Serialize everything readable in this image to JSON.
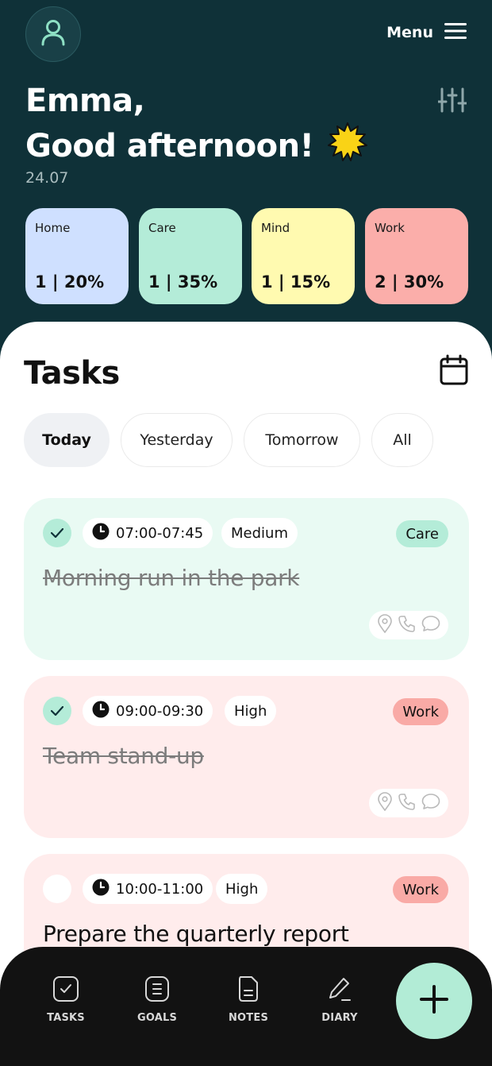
{
  "header": {
    "menu_label": "Menu",
    "name_line": "Emma,",
    "greeting_line": "Good afternoon!",
    "date": "24.07"
  },
  "categories": [
    {
      "name": "Home",
      "value": "1 | 20%",
      "color": "#cfe0ff"
    },
    {
      "name": "Care",
      "value": "1 | 35%",
      "color": "#b4ecd8"
    },
    {
      "name": "Mind",
      "value": "1 | 15%",
      "color": "#fffab0"
    },
    {
      "name": "Work",
      "value": "2 | 30%",
      "color": "#fbaeaa"
    }
  ],
  "tasks_section": {
    "title": "Tasks",
    "tabs": [
      {
        "label": "Today",
        "active": true
      },
      {
        "label": "Yesterday",
        "active": false
      },
      {
        "label": "Tomorrow",
        "active": false
      },
      {
        "label": "All",
        "active": false
      }
    ]
  },
  "tasks": [
    {
      "time": "07:00-07:45",
      "priority": "Medium",
      "category": "Care",
      "title": "Morning run in the park",
      "done": true,
      "card_color": "#e9faf3",
      "tag_color": "#b4ecd8"
    },
    {
      "time": "09:00-09:30",
      "priority": "High",
      "category": "Work",
      "title": "Team stand-up",
      "done": true,
      "card_color": "#ffecec",
      "tag_color": "#f9aaa6"
    },
    {
      "time": "10:00-11:00",
      "priority": "High",
      "category": "Work",
      "title": "Prepare the quarterly report",
      "done": false,
      "card_color": "#ffecec",
      "tag_color": "#f9aaa6"
    }
  ],
  "nav": {
    "items": [
      {
        "label": "TASKS",
        "icon": "tasks-icon"
      },
      {
        "label": "GOALS",
        "icon": "goals-icon"
      },
      {
        "label": "NOTES",
        "icon": "notes-icon"
      },
      {
        "label": "DIARY",
        "icon": "diary-icon"
      }
    ],
    "fab_icon": "plus-icon"
  },
  "colors": {
    "header_bg": "#0f3138",
    "accent_mint": "#b2ecd6",
    "nav_bg": "#121212"
  }
}
